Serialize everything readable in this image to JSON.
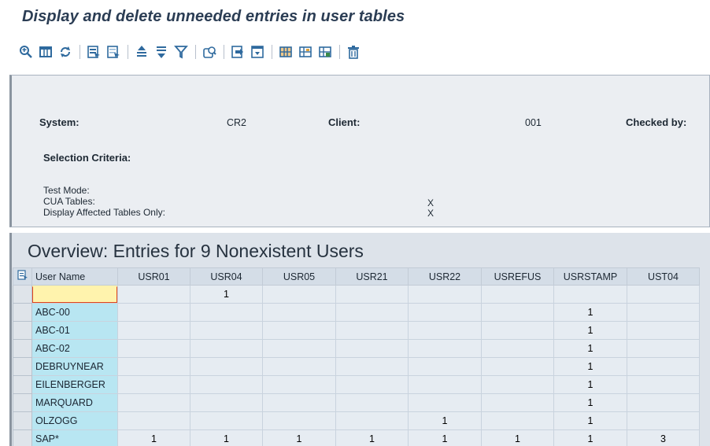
{
  "title": "Display and delete unneeded entries in user tables",
  "toolbar": {
    "buttons": [
      {
        "icon": "details-icon"
      },
      {
        "icon": "table-view-icon"
      },
      {
        "icon": "refresh-icon"
      },
      {
        "icon": "select-all-icon"
      },
      {
        "icon": "deselect-all-icon"
      },
      {
        "icon": "sort-ascending-icon"
      },
      {
        "icon": "sort-descending-icon"
      },
      {
        "icon": "filter-icon"
      },
      {
        "icon": "print-preview-icon"
      },
      {
        "icon": "export-icon"
      },
      {
        "icon": "view-icon"
      },
      {
        "icon": "layout-icon"
      },
      {
        "icon": "choose-layout-icon"
      },
      {
        "icon": "save-layout-icon"
      },
      {
        "icon": "delete-icon"
      }
    ]
  },
  "header": {
    "system_label": "System:",
    "system_value": "CR2",
    "client_label": "Client:",
    "client_value": "001",
    "checked_by_label": "Checked by:",
    "selection_criteria_label": "Selection Criteria:",
    "test_mode_label": "Test Mode:",
    "test_mode_value": "",
    "cua_tables_label": "CUA Tables:",
    "cua_tables_value": "X",
    "display_affected_label": "Display Affected Tables Only:",
    "display_affected_value": "X"
  },
  "overview": {
    "heading": "Overview: Entries for 9 Nonexistent Users",
    "columns": [
      "User Name",
      "USR01",
      "USR04",
      "USR05",
      "USR21",
      "USR22",
      "USREFUS",
      "USRSTAMP",
      "UST04"
    ],
    "rows": [
      {
        "user": "",
        "cells": [
          "",
          "1",
          "",
          "",
          "",
          "",
          "",
          ""
        ]
      },
      {
        "user": "ABC-00",
        "cells": [
          "",
          "",
          "",
          "",
          "",
          "",
          "1",
          ""
        ]
      },
      {
        "user": "ABC-01",
        "cells": [
          "",
          "",
          "",
          "",
          "",
          "",
          "1",
          ""
        ]
      },
      {
        "user": "ABC-02",
        "cells": [
          "",
          "",
          "",
          "",
          "",
          "",
          "1",
          ""
        ]
      },
      {
        "user": "DEBRUYNEAR",
        "cells": [
          "",
          "",
          "",
          "",
          "",
          "",
          "1",
          ""
        ]
      },
      {
        "user": "EILENBERGER",
        "cells": [
          "",
          "",
          "",
          "",
          "",
          "",
          "1",
          ""
        ]
      },
      {
        "user": "MARQUARD",
        "cells": [
          "",
          "",
          "",
          "",
          "",
          "",
          "1",
          ""
        ]
      },
      {
        "user": "OLZOGG",
        "cells": [
          "",
          "",
          "",
          "",
          "1",
          "",
          "1",
          ""
        ]
      },
      {
        "user": "SAP*",
        "cells": [
          "1",
          "1",
          "1",
          "1",
          "1",
          "1",
          "1",
          "3"
        ]
      }
    ]
  }
}
